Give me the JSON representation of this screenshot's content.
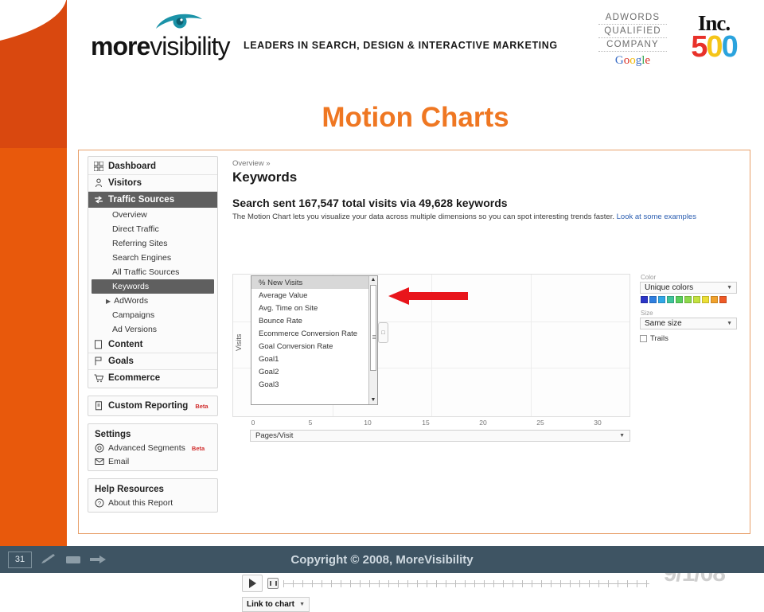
{
  "brand": {
    "logo_more": "more",
    "logo_visibility": "visibility",
    "tagline": "LEADERS IN SEARCH, DESIGN & INTERACTIVE MARKETING",
    "adwords": {
      "line1": "ADWORDS",
      "line2": "QUALIFIED",
      "line3": "COMPANY",
      "google": "Google"
    },
    "inc": {
      "word": "Inc.",
      "number": "500"
    }
  },
  "slide": {
    "title": "Motion Charts",
    "number": "31",
    "copyright": "Copyright © 2008,  MoreVisibility"
  },
  "ga_sidebar": {
    "main_nav": [
      {
        "label": "Dashboard",
        "icon": "dashboard-icon",
        "selected": false
      },
      {
        "label": "Visitors",
        "icon": "visitors-icon",
        "selected": false
      },
      {
        "label": "Traffic Sources",
        "icon": "traffic-sources-icon",
        "selected": true
      }
    ],
    "sub_nav": [
      {
        "label": "Overview",
        "selected": false,
        "expandable": false
      },
      {
        "label": "Direct Traffic",
        "selected": false,
        "expandable": false
      },
      {
        "label": "Referring Sites",
        "selected": false,
        "expandable": false
      },
      {
        "label": "Search Engines",
        "selected": false,
        "expandable": false
      },
      {
        "label": "All Traffic Sources",
        "selected": false,
        "expandable": false
      },
      {
        "label": "Keywords",
        "selected": true,
        "expandable": false
      },
      {
        "label": "AdWords",
        "selected": false,
        "expandable": true
      },
      {
        "label": "Campaigns",
        "selected": false,
        "expandable": false
      },
      {
        "label": "Ad Versions",
        "selected": false,
        "expandable": false
      }
    ],
    "main_nav_bottom": [
      {
        "label": "Content",
        "icon": "content-icon"
      },
      {
        "label": "Goals",
        "icon": "goals-flag-icon"
      },
      {
        "label": "Ecommerce",
        "icon": "ecommerce-cart-icon"
      }
    ],
    "custom_reporting": {
      "label": "Custom Reporting",
      "badge": "Beta",
      "icon": "report-icon"
    },
    "settings": {
      "title": "Settings",
      "items": [
        {
          "label": "Advanced Segments",
          "badge": "Beta",
          "icon": "segments-icon"
        },
        {
          "label": "Email",
          "badge": "",
          "icon": "email-icon"
        }
      ]
    },
    "help": {
      "title": "Help Resources",
      "items": [
        {
          "label": "About this Report",
          "icon": "question-icon"
        }
      ]
    }
  },
  "ga_main": {
    "breadcrumb": "Overview »",
    "page_title": "Keywords",
    "summary": "Search sent 167,547 total visits via 49,628 keywords",
    "description": "The Motion Chart lets you visualize your data across multiple dimensions so you can spot interesting trends faster. ",
    "description_link": "Look at some examples",
    "date_display": "9/1/08",
    "link_to_chart": "Link to chart",
    "play_button": "play-button"
  },
  "chart_data": {
    "type": "scatter",
    "title": "Motion Chart",
    "xlabel": "Pages/Visit",
    "ylabel": "Visits",
    "x_ticks": [
      0,
      5,
      10,
      15,
      20,
      25,
      30
    ],
    "xlim": [
      0,
      33
    ],
    "grid": true,
    "series": [],
    "y_metric_options": [
      "% New Visits",
      "Average Value",
      "Avg. Time on Site",
      "Bounce Rate",
      "Ecommerce Conversion Rate",
      "Goal Conversion Rate",
      "Goal1",
      "Goal2",
      "Goal3"
    ],
    "y_metric_selected": "% New Visits",
    "annotation": "red-left-arrow pointing at metric dropdown"
  },
  "chart_controls": {
    "color_label": "Color",
    "color_value": "Unique colors",
    "size_label": "Size",
    "size_value": "Same size",
    "trails_label": "Trails",
    "swatches": [
      "#2b35c8",
      "#2f7fe0",
      "#31a8e8",
      "#3fc49a",
      "#59cf5c",
      "#8ed94b",
      "#c4e23f",
      "#ecdf36",
      "#f2a22c",
      "#ef5a26"
    ]
  },
  "colors": {
    "orange_band": "#d9480f",
    "orange_band_lower": "#e8590c",
    "title_orange": "#ef7722",
    "footer": "#3e5463",
    "arrow_red": "#e8151b",
    "selected_nav": "#5f5f5f"
  }
}
